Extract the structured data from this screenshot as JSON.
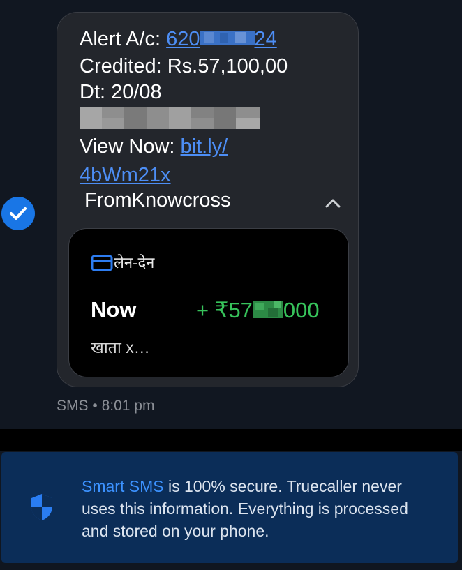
{
  "message": {
    "alert_prefix": "Alert A/c: ",
    "account_start": "620",
    "account_end": "24",
    "credited": "Credited: Rs.57,100,00",
    "date": "Dt: 20/08",
    "view_prefix": "View Now: ",
    "link_part1": "bit.ly/",
    "link_part2": "4bWm21x",
    "sender": "FromKnowcross",
    "selected_icon": "check-circle-icon"
  },
  "card": {
    "category": "लेन-देन",
    "category_icon": "card-icon",
    "time": "Now",
    "amount_start": "+ ₹57",
    "amount_end": "000",
    "account_snippet": "खाता x…",
    "amount_color": "#37c35b"
  },
  "meta": {
    "channel": "SMS",
    "separator": "•",
    "time": "8:01 pm"
  },
  "banner": {
    "highlight": "Smart SMS",
    "text": " is 100% secure. Truecaller never uses this information. Everything is processed and stored on your phone.",
    "icon": "shield-icon"
  },
  "colors": {
    "accent": "#1976e6",
    "link": "#4d8ef5",
    "banner_bg": "#0b2d58"
  }
}
